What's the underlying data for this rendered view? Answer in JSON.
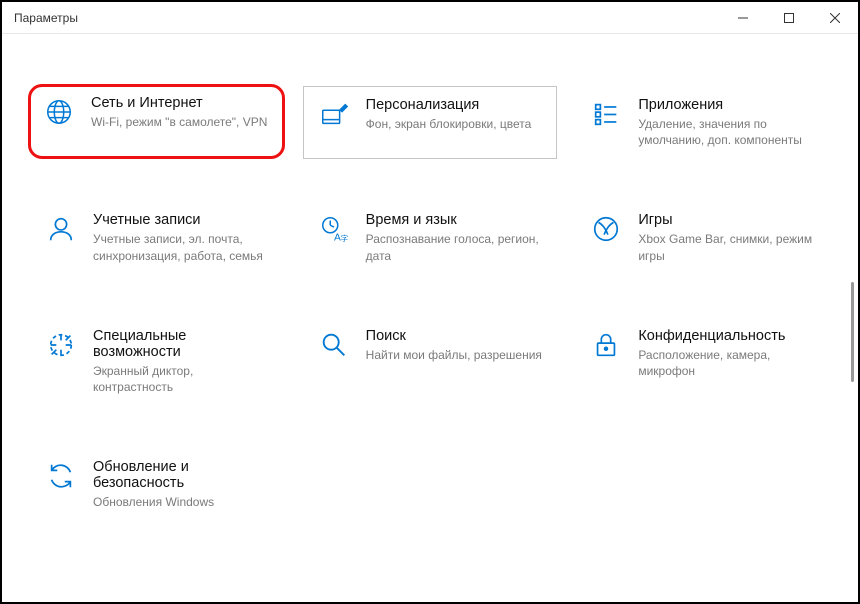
{
  "window": {
    "title": "Параметры"
  },
  "tiles": [
    {
      "title": "Сеть и Интернет",
      "desc": "Wi-Fi, режим \"в самолете\", VPN"
    },
    {
      "title": "Персонализация",
      "desc": "Фон, экран блокировки, цвета"
    },
    {
      "title": "Приложения",
      "desc": "Удаление, значения по умолчанию, доп. компоненты"
    },
    {
      "title": "Учетные записи",
      "desc": "Учетные записи, эл. почта, синхронизация, работа, семья"
    },
    {
      "title": "Время и язык",
      "desc": "Распознавание голоса, регион, дата"
    },
    {
      "title": "Игры",
      "desc": "Xbox Game Bar, снимки, режим игры"
    },
    {
      "title": "Специальные возможности",
      "desc": "Экранный диктор, контрастность"
    },
    {
      "title": "Поиск",
      "desc": "Найти мои файлы, разрешения"
    },
    {
      "title": "Конфиденциальность",
      "desc": "Расположение, камера, микрофон"
    },
    {
      "title": "Обновление и безопасность",
      "desc": "Обновления Windows"
    }
  ]
}
